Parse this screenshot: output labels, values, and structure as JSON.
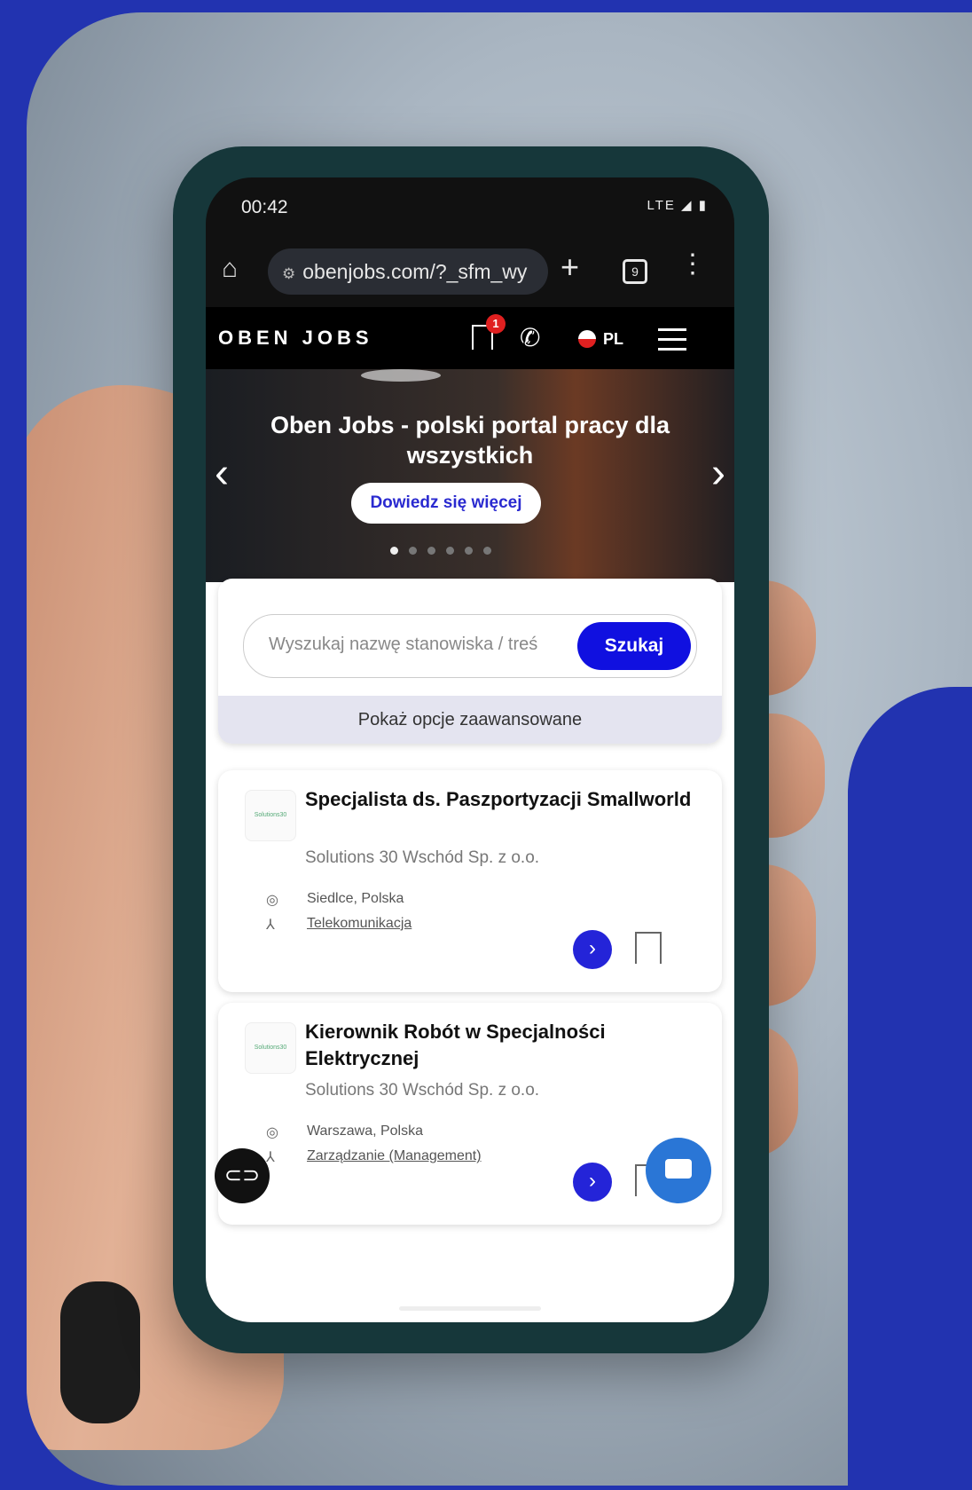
{
  "status_bar": {
    "time": "00:42",
    "system": "LTE"
  },
  "browser": {
    "url": "obenjobs.com/?_sfm_wy",
    "tab_count": "9"
  },
  "site": {
    "logo": "OBEN JOBS",
    "bookmark_count": "1",
    "language": "PL"
  },
  "hero": {
    "title": "Oben Jobs - polski portal pracy dla wszystkich",
    "button": "Dowiedz się więcej",
    "slides": 6,
    "active_slide": 1
  },
  "search": {
    "placeholder": "Wyszukaj nazwę stanowiska / treś",
    "button": "Szukaj",
    "advanced": "Pokaż opcje zaawansowane"
  },
  "jobs": [
    {
      "title": "Specjalista ds. Paszportyzacji Smallworld",
      "company": "Solutions 30 Wschód Sp. z o.o.",
      "location": "Siedlce, Polska",
      "category": "Telekomunikacja"
    },
    {
      "title": "Kierownik Robót w Specjalności Elektrycznej",
      "company": "Solutions 30 Wschód Sp. z o.o.",
      "location": "Warszawa, Polska",
      "category": "Zarządzanie (Management)"
    }
  ],
  "colors": {
    "brand_blue": "#2233b0",
    "primary_button": "#1010e0",
    "chat_fab": "#2a76d6"
  }
}
